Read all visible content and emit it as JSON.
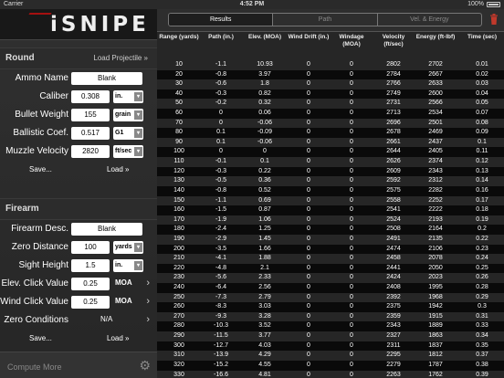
{
  "statusbar": {
    "carrier": "Carrier",
    "time": "4:52 PM",
    "battery": "100%"
  },
  "app": {
    "title": "iSNIPE"
  },
  "round": {
    "header": "Round",
    "load_projectile": "Load Projectile »",
    "rows": [
      {
        "label": "Ammo Name",
        "value": "Blank",
        "unit": ""
      },
      {
        "label": "Caliber",
        "value": "0.308",
        "unit": "in."
      },
      {
        "label": "Bullet Weight",
        "value": "155",
        "unit": "grain"
      },
      {
        "label": "Ballistic Coef.",
        "value": "0.517",
        "unit": "G1"
      },
      {
        "label": "Muzzle Velocity",
        "value": "2820",
        "unit": "ft/sec"
      }
    ],
    "save": "Save...",
    "load": "Load »"
  },
  "firearm": {
    "header": "Firearm",
    "rows": [
      {
        "label": "Firearm Desc.",
        "value": "Blank"
      },
      {
        "label": "Zero Distance",
        "value": "100",
        "unit": "yards"
      },
      {
        "label": "Sight Height",
        "value": "1.5",
        "unit": "in."
      },
      {
        "label": "Elev. Click Value",
        "value": "0.25",
        "unit": "MOA"
      },
      {
        "label": "Wind Click Value",
        "value": "0.25",
        "unit": "MOA"
      },
      {
        "label": "Zero Conditions",
        "value": "N/A"
      }
    ],
    "save": "Save...",
    "load": "Load »"
  },
  "bottom": {
    "compute_more": "Compute More"
  },
  "tabs": [
    "Results",
    "Path",
    "Vel. & Energy"
  ],
  "active_tab": 0,
  "columns": [
    "Range (yards)",
    "Path (in.)",
    "Elev. (MOA)",
    "Wind Drift (in.)",
    "Windage (MOA)",
    "Velocity (ft/sec)",
    "Energy (ft-lbf)",
    "Time (sec)"
  ],
  "rows": [
    [
      "10",
      "-1.1",
      "10.93",
      "0",
      "0",
      "2802",
      "2702",
      "0.01"
    ],
    [
      "20",
      "-0.8",
      "3.97",
      "0",
      "0",
      "2784",
      "2667",
      "0.02"
    ],
    [
      "30",
      "-0.6",
      "1.8",
      "0",
      "0",
      "2766",
      "2633",
      "0.03"
    ],
    [
      "40",
      "-0.3",
      "0.82",
      "0",
      "0",
      "2749",
      "2600",
      "0.04"
    ],
    [
      "50",
      "-0.2",
      "0.32",
      "0",
      "0",
      "2731",
      "2566",
      "0.05"
    ],
    [
      "60",
      "0",
      "0.06",
      "0",
      "0",
      "2713",
      "2534",
      "0.07"
    ],
    [
      "70",
      "0",
      "-0.06",
      "0",
      "0",
      "2696",
      "2501",
      "0.08"
    ],
    [
      "80",
      "0.1",
      "-0.09",
      "0",
      "0",
      "2678",
      "2469",
      "0.09"
    ],
    [
      "90",
      "0.1",
      "-0.06",
      "0",
      "0",
      "2661",
      "2437",
      "0.1"
    ],
    [
      "100",
      "0",
      "0",
      "0",
      "0",
      "2644",
      "2405",
      "0.11"
    ],
    [
      "110",
      "-0.1",
      "0.1",
      "0",
      "0",
      "2626",
      "2374",
      "0.12"
    ],
    [
      "120",
      "-0.3",
      "0.22",
      "0",
      "0",
      "2609",
      "2343",
      "0.13"
    ],
    [
      "130",
      "-0.5",
      "0.36",
      "0",
      "0",
      "2592",
      "2312",
      "0.14"
    ],
    [
      "140",
      "-0.8",
      "0.52",
      "0",
      "0",
      "2575",
      "2282",
      "0.16"
    ],
    [
      "150",
      "-1.1",
      "0.69",
      "0",
      "0",
      "2558",
      "2252",
      "0.17"
    ],
    [
      "160",
      "-1.5",
      "0.87",
      "0",
      "0",
      "2541",
      "2222",
      "0.18"
    ],
    [
      "170",
      "-1.9",
      "1.06",
      "0",
      "0",
      "2524",
      "2193",
      "0.19"
    ],
    [
      "180",
      "-2.4",
      "1.25",
      "0",
      "0",
      "2508",
      "2164",
      "0.2"
    ],
    [
      "190",
      "-2.9",
      "1.45",
      "0",
      "0",
      "2491",
      "2135",
      "0.22"
    ],
    [
      "200",
      "-3.5",
      "1.66",
      "0",
      "0",
      "2474",
      "2106",
      "0.23"
    ],
    [
      "210",
      "-4.1",
      "1.88",
      "0",
      "0",
      "2458",
      "2078",
      "0.24"
    ],
    [
      "220",
      "-4.8",
      "2.1",
      "0",
      "0",
      "2441",
      "2050",
      "0.25"
    ],
    [
      "230",
      "-5.6",
      "2.33",
      "0",
      "0",
      "2424",
      "2023",
      "0.26"
    ],
    [
      "240",
      "-6.4",
      "2.56",
      "0",
      "0",
      "2408",
      "1995",
      "0.28"
    ],
    [
      "250",
      "-7.3",
      "2.79",
      "0",
      "0",
      "2392",
      "1968",
      "0.29"
    ],
    [
      "260",
      "-8.3",
      "3.03",
      "0",
      "0",
      "2375",
      "1942",
      "0.3"
    ],
    [
      "270",
      "-9.3",
      "3.28",
      "0",
      "0",
      "2359",
      "1915",
      "0.31"
    ],
    [
      "280",
      "-10.3",
      "3.52",
      "0",
      "0",
      "2343",
      "1889",
      "0.33"
    ],
    [
      "290",
      "-11.5",
      "3.77",
      "0",
      "0",
      "2327",
      "1863",
      "0.34"
    ],
    [
      "300",
      "-12.7",
      "4.03",
      "0",
      "0",
      "2311",
      "1837",
      "0.35"
    ],
    [
      "310",
      "-13.9",
      "4.29",
      "0",
      "0",
      "2295",
      "1812",
      "0.37"
    ],
    [
      "320",
      "-15.2",
      "4.55",
      "0",
      "0",
      "2279",
      "1787",
      "0.38"
    ],
    [
      "330",
      "-16.6",
      "4.81",
      "0",
      "0",
      "2263",
      "1762",
      "0.39"
    ]
  ]
}
